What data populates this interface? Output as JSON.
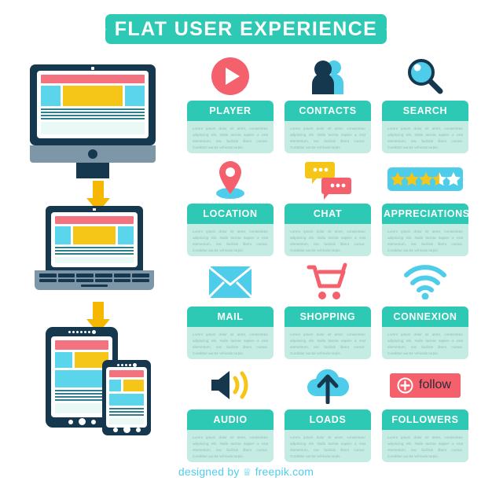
{
  "title": {
    "text": "FLAT USER EXPERIENCE",
    "dot": "·",
    "banner_color": "#2dc9b4"
  },
  "body_text": "Lorem ipsum dolor sit amet, consectetur adipiscing elit. Nulla lacinia sapien a erat elementum, nec facilisis libero cursus. Curabitur auctor vehicula turpis.",
  "cards": [
    {
      "label": "PLAYER",
      "icon": "play-button-icon"
    },
    {
      "label": "CONTACTS",
      "icon": "contacts-people-icon"
    },
    {
      "label": "SEARCH",
      "icon": "magnifier-search-icon"
    },
    {
      "label": "LOCATION",
      "icon": "map-pin-icon"
    },
    {
      "label": "CHAT",
      "icon": "speech-bubbles-icon"
    },
    {
      "label": "APPRECIATIONS",
      "icon": "star-rating-icon"
    },
    {
      "label": "MAIL",
      "icon": "envelope-icon"
    },
    {
      "label": "SHOPPING",
      "icon": "shopping-cart-icon"
    },
    {
      "label": "CONNEXION",
      "icon": "wifi-icon"
    },
    {
      "label": "AUDIO",
      "icon": "speaker-volume-icon"
    },
    {
      "label": "LOADS",
      "icon": "cloud-upload-icon"
    },
    {
      "label": "FOLLOWERS",
      "icon": "follow-button-icon"
    }
  ],
  "follow_button": {
    "label": "follow",
    "color": "#f4606c"
  },
  "rating": {
    "full_stars": 3,
    "half_stars": 1,
    "empty_stars": 1,
    "bar_color": "#4ecdea",
    "star_color": "#f5c518"
  },
  "devices": [
    {
      "name": "desktop-monitor"
    },
    {
      "name": "laptop"
    },
    {
      "name": "tablet-and-phone"
    }
  ],
  "arrows": [
    {
      "name": "down-arrow",
      "color": "#f5b700"
    },
    {
      "name": "down-arrow",
      "color": "#f5b700"
    }
  ],
  "footer": {
    "prefix": "designed by",
    "brand": "freepik.com",
    "color": "#4ecdea"
  },
  "palette": {
    "teal": "#2dc9b4",
    "mint": "#c5ece2",
    "navy": "#16384f",
    "coral": "#f4606c",
    "cyan": "#4ecdea",
    "yellow": "#f5c518",
    "slate": "#7d97a8"
  }
}
